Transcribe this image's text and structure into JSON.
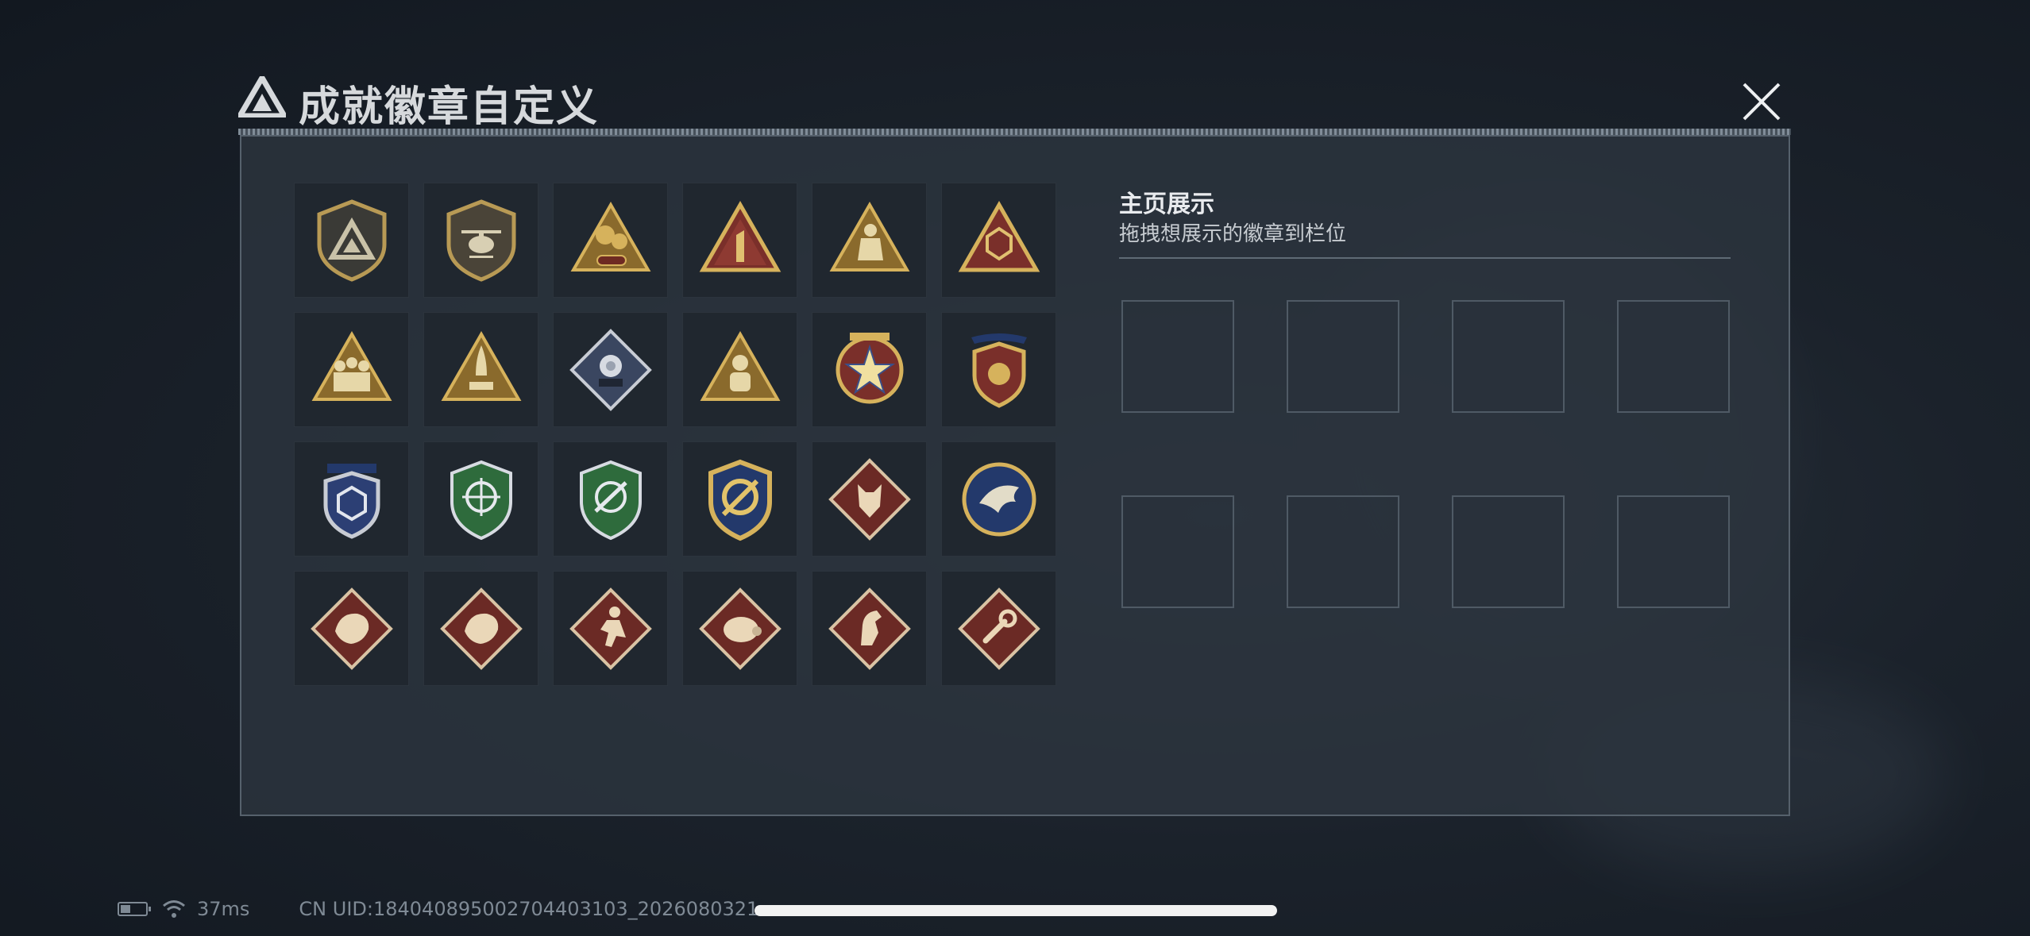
{
  "header": {
    "title": "成就徽章自定义"
  },
  "right_panel": {
    "title": "主页展示",
    "subtitle": "拖拽想展示的徽章到栏位",
    "slot_count": 8
  },
  "badges": [
    {
      "icon": "shield-delta-badge-icon"
    },
    {
      "icon": "helicopter-shield-badge-icon"
    },
    {
      "icon": "sbf-gold-triangle-badge-icon"
    },
    {
      "icon": "number-one-triangle-badge-icon"
    },
    {
      "icon": "kneeling-soldier-triangle-badge-icon"
    },
    {
      "icon": "hex-emblem-triangle-badge-icon"
    },
    {
      "icon": "squad-triangle-badge-icon"
    },
    {
      "icon": "rocket-triangle-badge-icon"
    },
    {
      "icon": "rose-diamond-badge-icon"
    },
    {
      "icon": "astronaut-triangle-badge-icon"
    },
    {
      "icon": "star-medal-badge-icon"
    },
    {
      "icon": "winged-shield-badge-icon"
    },
    {
      "icon": "blue-laurel-shield-badge-icon"
    },
    {
      "icon": "green-crosshair-shield-badge-icon"
    },
    {
      "icon": "green-crosshair-shield-badge-2-icon"
    },
    {
      "icon": "gold-slash-shield-badge-icon"
    },
    {
      "icon": "wolf-diamond-badge-icon"
    },
    {
      "icon": "eagle-round-badge-icon"
    },
    {
      "icon": "dragon-diamond-badge-icon"
    },
    {
      "icon": "dragon-diamond-badge-2-icon"
    },
    {
      "icon": "runner-diamond-badge-icon"
    },
    {
      "icon": "boar-diamond-badge-icon"
    },
    {
      "icon": "horse-diamond-badge-icon"
    },
    {
      "icon": "wrench-diamond-badge-icon"
    }
  ],
  "status_bar": {
    "ping": "37ms",
    "uid": "CN UID:184040895002704403103_2026080321",
    "battery_level": 0.4
  },
  "colors": {
    "gold": "#c9a24a",
    "bronze": "#8a6a2c",
    "maroon": "#7a2f2a",
    "navy": "#23396b",
    "green": "#2e6b3c",
    "silver": "#b7bcc4"
  }
}
